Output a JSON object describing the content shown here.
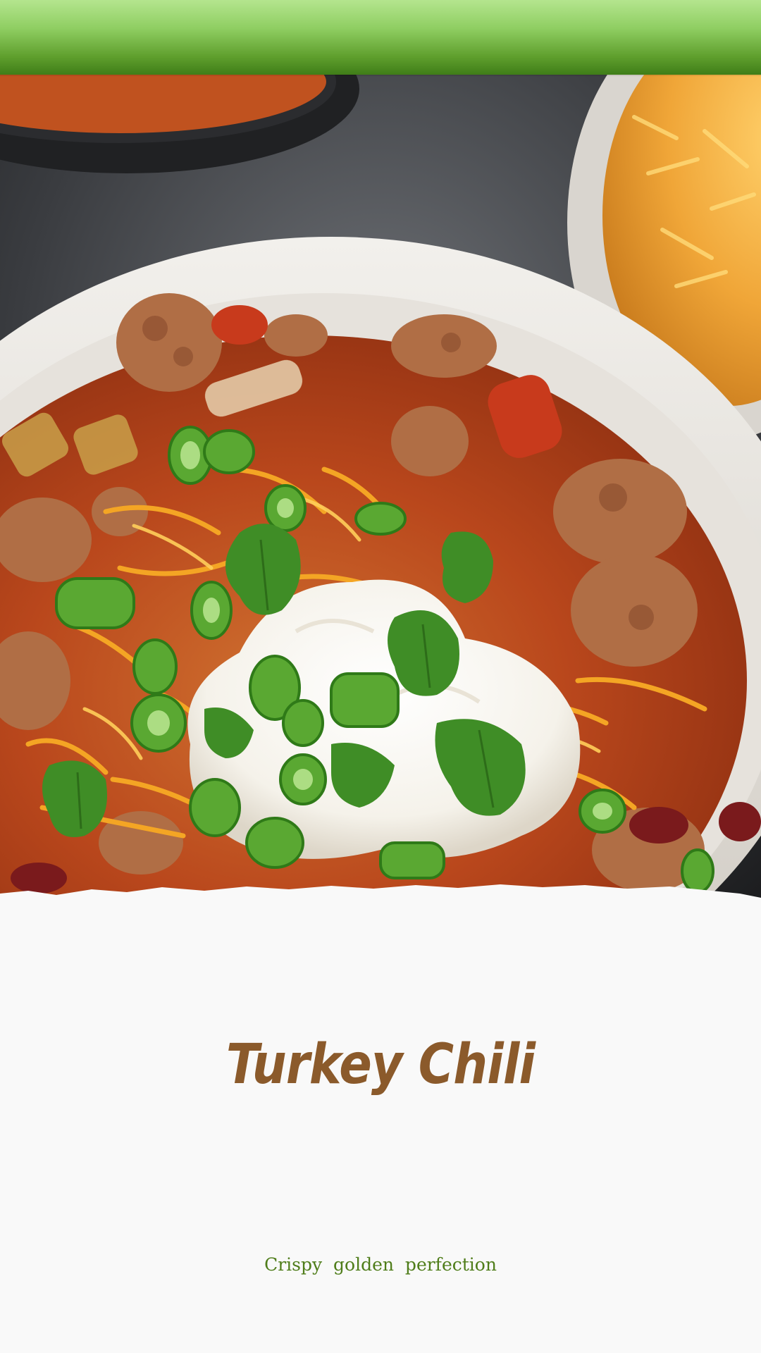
{
  "header": {
    "bar_color_top": "#b4e58e",
    "bar_color_bottom": "#3f7d18"
  },
  "hero_image": {
    "icon": "turkey-chili-bowl-photo"
  },
  "recipe": {
    "title": "Turkey Chili",
    "subtitle": "Crispy  golden  perfection",
    "title_color": "#8b5a2b",
    "subtitle_color": "#4f7d1a"
  }
}
